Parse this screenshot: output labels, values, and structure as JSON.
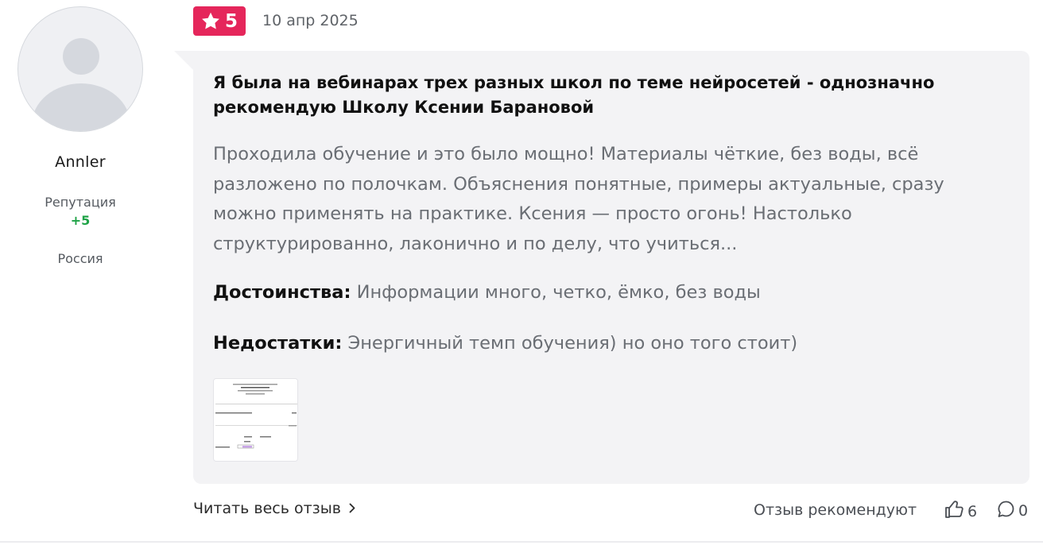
{
  "author": {
    "name": "Annler",
    "reputation_label": "Репутация",
    "reputation_value": "+5",
    "country": "Россия",
    "avatar_icon": "user-placeholder-icon"
  },
  "review": {
    "rating": "5",
    "rating_icon": "star-icon",
    "date": "10 апр 2025",
    "title": "Я была на вебинарах трех разных школ по теме нейросетей - однозначно рекомендую Школу Ксении Барановой",
    "body": "Проходила обучение и это было мощно! Материалы чёткие, без воды, всё разложено по полочкам. Объяснения понятные, примеры актуальные, сразу можно применять на практике. Ксения — просто огонь! Настолько структурированно, лаконично и по делу, что учиться...",
    "pros_label": "Достоинства:",
    "pros_text": "Информации много, четко, ёмко, без воды",
    "cons_label": "Недостатки:",
    "cons_text": "Энергичный темп обучения) но оно того стоит)"
  },
  "footer": {
    "read_more": "Читать весь отзыв",
    "recommend_text": "Отзыв рекомендуют",
    "likes": "6",
    "comments": "0"
  },
  "colors": {
    "badge": "#e5265b",
    "reputation": "#1fa347",
    "bubble": "#f3f3f5"
  }
}
